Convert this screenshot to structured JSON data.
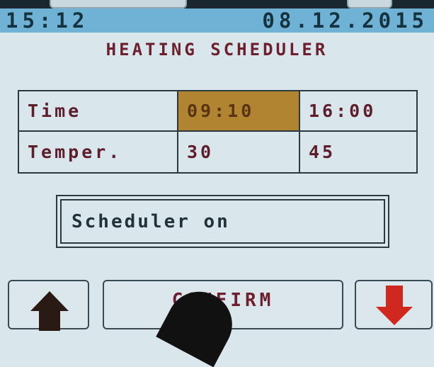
{
  "status_bar": {
    "time": "15:12",
    "date": "08.12.2015"
  },
  "title": "HEATING SCHEDULER",
  "schedule": {
    "rows": [
      {
        "label": "Time",
        "values": [
          "09:10",
          "16:00"
        ]
      },
      {
        "label": "Temper.",
        "values": [
          "30",
          "45"
        ]
      }
    ],
    "selected_cell": "09:10"
  },
  "scheduler_status": "Scheduler on",
  "buttons": {
    "up_icon": "arrow-up-icon",
    "confirm": "CONFIRM",
    "down_icon": "arrow-down-icon"
  },
  "colors": {
    "status_bar": "#6fb2d6",
    "selected_cell": "#b08431",
    "down_arrow": "#d0281f",
    "up_arrow": "#2a1a14"
  }
}
